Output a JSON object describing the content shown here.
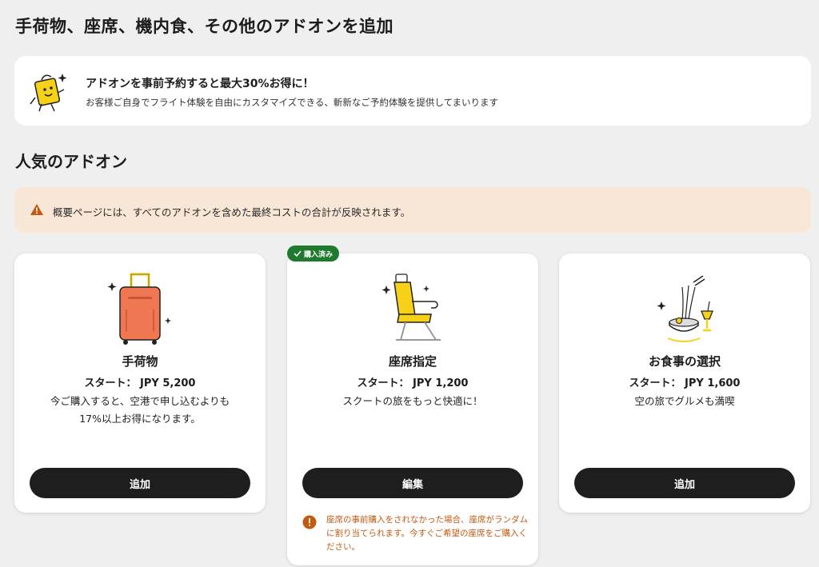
{
  "page": {
    "title": "手荷物、座席、機内食、その他のアドオンを追加"
  },
  "promo": {
    "title": "アドオンを事前予約すると最大30%お得に！",
    "subtitle": "お客様ご自身でフライト体験を自由にカスタマイズできる、斬新なご予約体験を提供してまいります",
    "icon": "mascot-icon"
  },
  "popular": {
    "title": "人気のアドオン"
  },
  "notice": {
    "icon": "warning-icon",
    "text": "概要ページには、すべてのアドオンを含めた最終コストの合計が反映されます。",
    "bg_color": "#f8e6d6"
  },
  "cards": [
    {
      "title": "手荷物",
      "price": "スタート： JPY 5,200",
      "description": "今ご購入すると、空港で申し込むよりも17%以上お得になります。",
      "button": "追加",
      "icon": "suitcase-icon"
    },
    {
      "title": "座席指定",
      "price": "スタート： JPY 1,200",
      "description": "スクートの旅をもっと快適に！",
      "button": "編集",
      "icon": "seat-icon",
      "badge": "購入済み",
      "badge_color": "#1f7a2e",
      "warning": "座席の事前購入をされなかった場合、座席がランダムに割り当てられます。今すぐご希望の座席をご購入ください。",
      "warning_color": "#c25a10"
    },
    {
      "title": "お食事の選択",
      "price": "スタート： JPY 1,600",
      "description": "空の旅でグルメも満喫",
      "button": "追加",
      "icon": "meal-icon"
    }
  ],
  "colors": {
    "background": "#efefef",
    "button": "#1e1e1e",
    "accent_yellow": "#f7d117",
    "luggage_orange": "#ef7752"
  }
}
